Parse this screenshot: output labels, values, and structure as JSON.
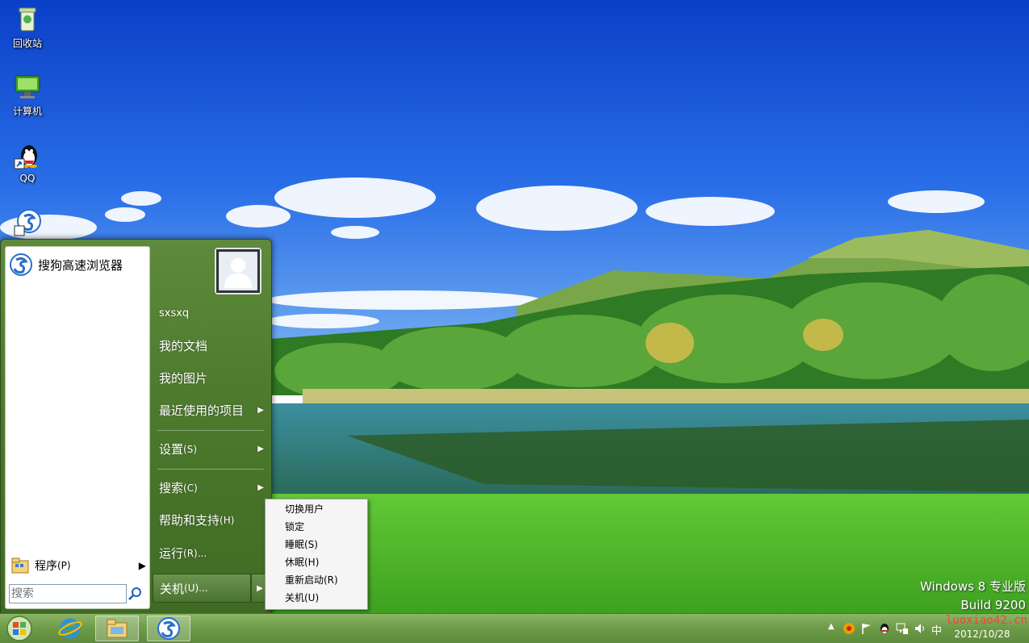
{
  "desktop": {
    "icons": [
      {
        "label": "回收站"
      },
      {
        "label": "计算机"
      },
      {
        "label": "QQ"
      }
    ]
  },
  "start_menu": {
    "pinned": [
      {
        "label": "搜狗高速浏览器"
      }
    ],
    "programs_label": "程序",
    "programs_key": "(P)",
    "search_placeholder": "搜索",
    "user_name": "sxsxq",
    "right_items": [
      {
        "label": "我的文档"
      },
      {
        "label": "我的图片"
      },
      {
        "label": "最近使用的项目"
      },
      {
        "label": "设置",
        "key": "(S)"
      },
      {
        "label": "搜索",
        "key": "(C)"
      },
      {
        "label": "帮助和支持",
        "key": "(H)"
      },
      {
        "label": "运行",
        "key": "(R)..."
      }
    ],
    "shutdown_label": "关机",
    "shutdown_key": "(U)..."
  },
  "power_menu": {
    "items": [
      {
        "label": "切换用户"
      },
      {
        "label": "锁定"
      },
      {
        "label": "睡眠(S)"
      },
      {
        "label": "休眠(H)"
      },
      {
        "label": "重新启动(R)"
      },
      {
        "label": "关机(U)"
      }
    ]
  },
  "watermark": {
    "line1": "Windows 8 专业版",
    "line2": "Build 9200"
  },
  "taskbar": {
    "clock_date": "2012/10/28",
    "ime": "中",
    "site_watermark": "luoxiao42.cn"
  },
  "colors": {
    "accent": "#4e7b2e",
    "taskbar": "#6c9a47",
    "sky": "#1a5be0",
    "grass": "#4fbf2a"
  }
}
